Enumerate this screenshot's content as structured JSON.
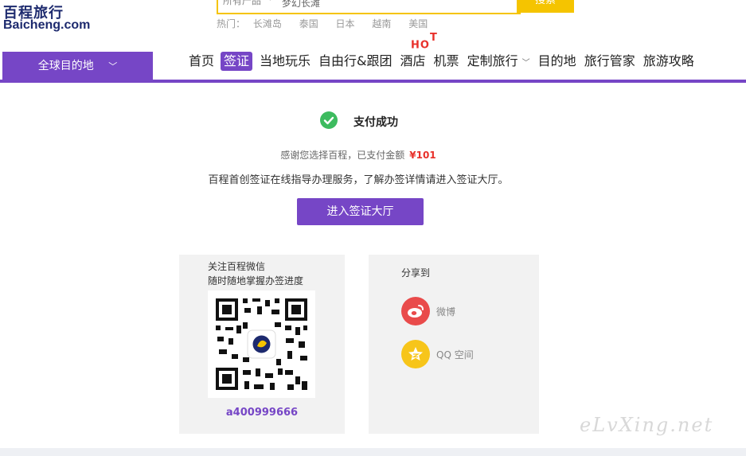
{
  "logo": {
    "cn": "百程旅行",
    "en": "Baicheng.com"
  },
  "search": {
    "category": "所有产品",
    "value": "梦幻长滩",
    "button": "搜索"
  },
  "hot": {
    "label": "热门：",
    "items": [
      "长滩岛",
      "泰国",
      "日本",
      "越南",
      "美国"
    ]
  },
  "nav": {
    "global_dest": "全球目的地",
    "items": [
      "首页",
      "签证",
      "当地玩乐",
      "自由行&跟团",
      "酒店",
      "机票",
      "定制旅行",
      "目的地",
      "旅行管家",
      "旅游攻略"
    ],
    "hot_badge": {
      "a": "HO",
      "b": "T"
    }
  },
  "result": {
    "title": "支付成功",
    "thanks": "感谢您选择百程，已支付金额",
    "amount": "¥101",
    "desc": "百程首创签证在线指导办理服务，了解办签详情请进入签证大厅。",
    "button": "进入签证大厅"
  },
  "wechat": {
    "line1": "关注百程微信",
    "line2": "随时随地掌握办签进度",
    "id": "a400999666"
  },
  "share": {
    "title": "分享到",
    "weibo": "微博",
    "qzone": "QQ 空间"
  },
  "watermark": "eLvXing.net",
  "colors": {
    "brand": "#7646c6",
    "accent": "#f5c400",
    "price": "#e8302a",
    "success": "#3dbb5f"
  }
}
